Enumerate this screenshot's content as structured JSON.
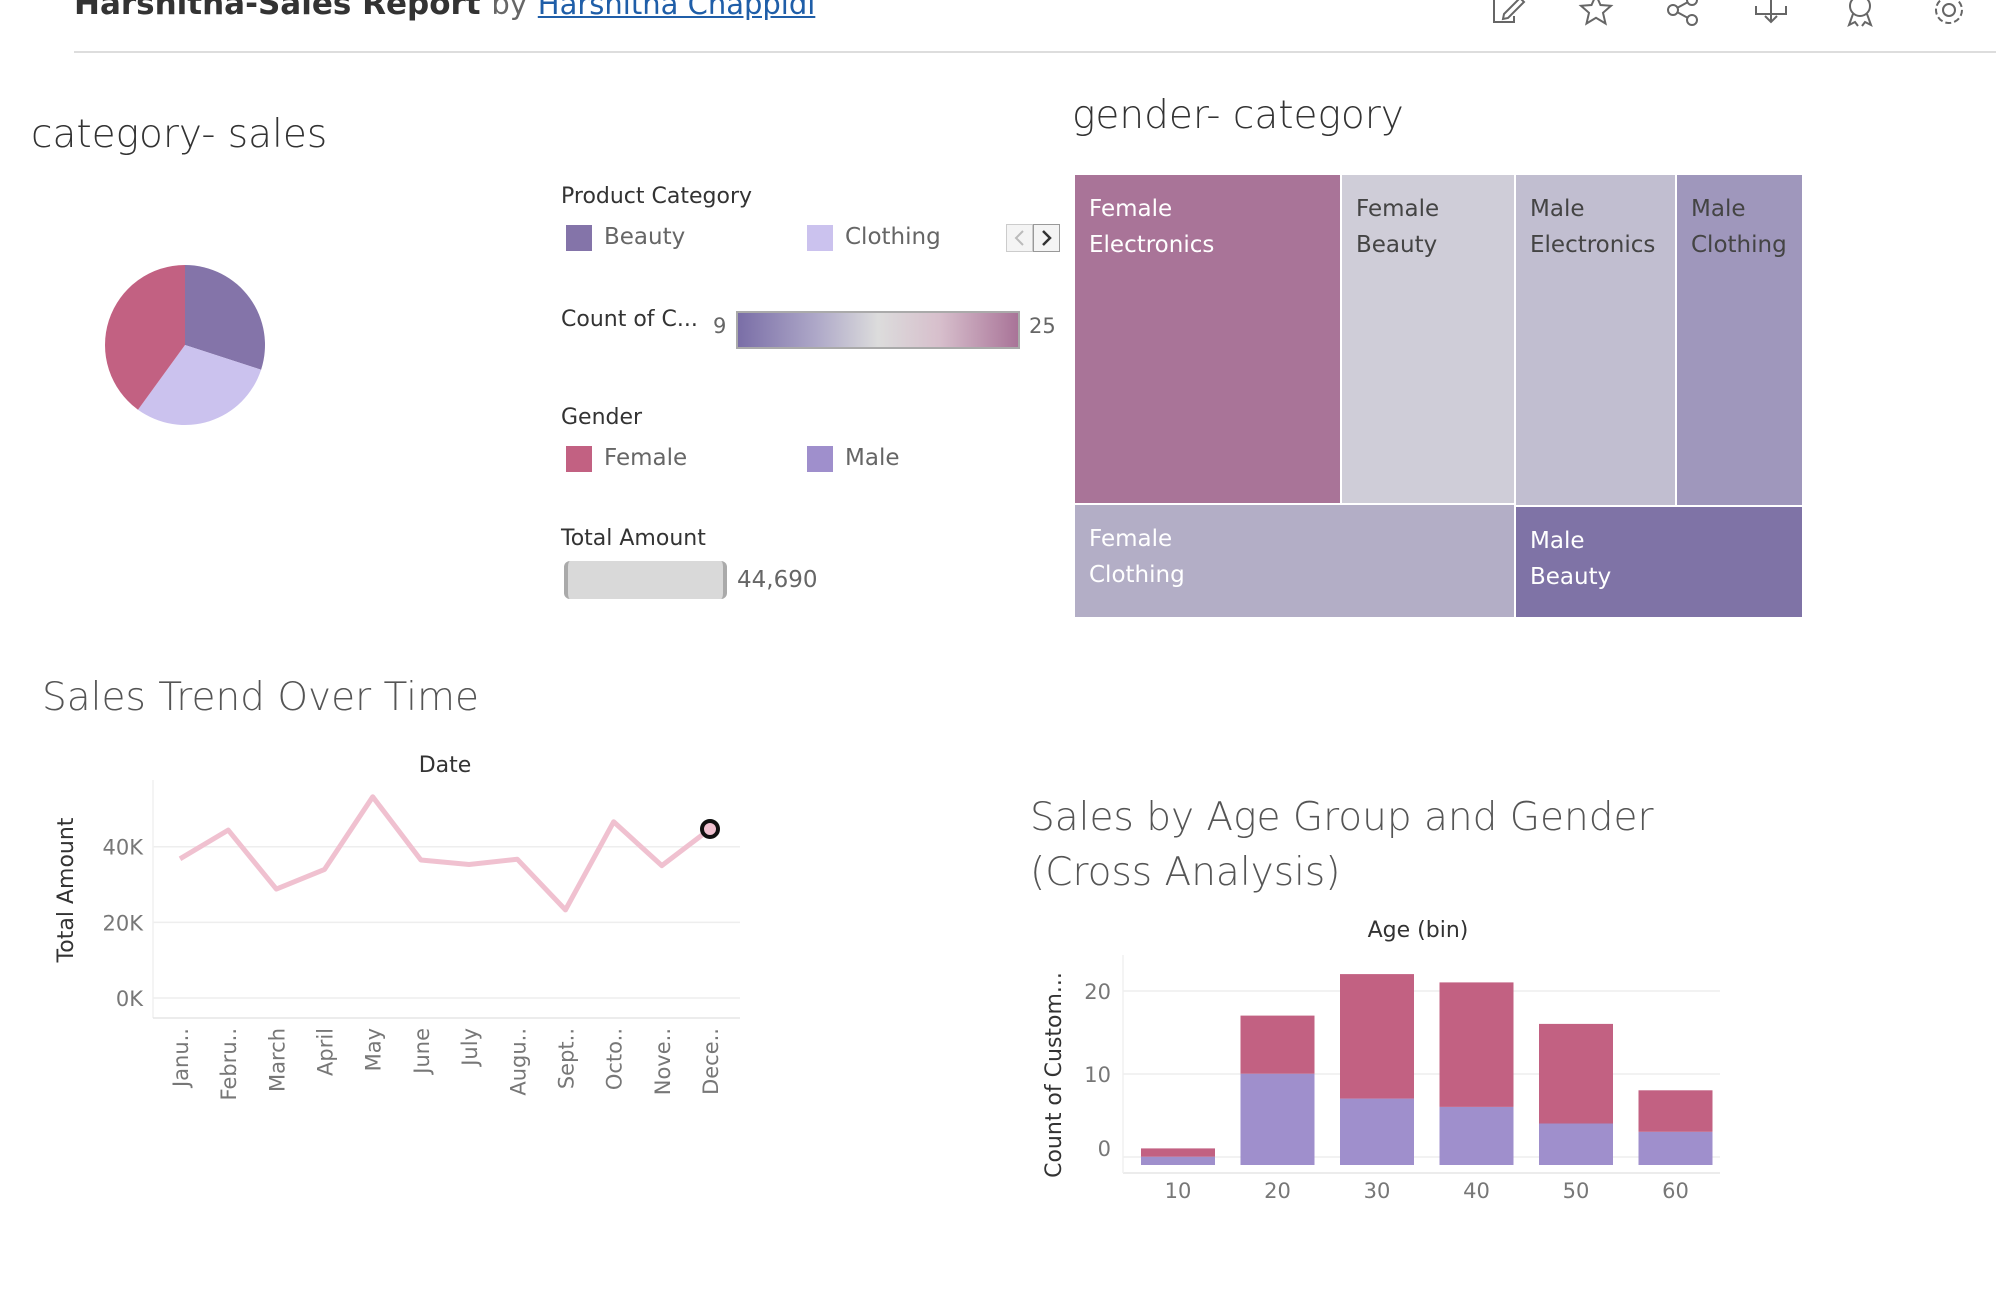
{
  "header": {
    "title": "Harshitha-Sales Report",
    "by": "by",
    "author": "Harshitha Chappidi",
    "icons": [
      "edit-icon",
      "star-icon",
      "share-icon",
      "download-icon",
      "badge-icon",
      "gear-icon"
    ]
  },
  "pie": {
    "title": "category- sales",
    "slices": [
      {
        "category": "Beauty",
        "fraction": 0.3,
        "color": "#8474a9"
      },
      {
        "category": "Clothing",
        "fraction": 0.3,
        "color": "#cbc2ee"
      },
      {
        "category": "Electronics",
        "fraction": 0.4,
        "color": "#c26182"
      }
    ]
  },
  "legends": {
    "product_category": {
      "title": "Product Category",
      "items": [
        {
          "label": "Beauty",
          "color": "#8474a9"
        },
        {
          "label": "Clothing",
          "color": "#cbc2ee"
        }
      ]
    },
    "count": {
      "title": "Count of C...",
      "min": "9",
      "max": "25"
    },
    "gender": {
      "title": "Gender",
      "items": [
        {
          "label": "Female",
          "color": "#c26182"
        },
        {
          "label": "Male",
          "color": "#9f8fcc"
        }
      ]
    },
    "total": {
      "title": "Total Amount",
      "value": "44,690"
    }
  },
  "treemap": {
    "title": "gender- category",
    "cells": [
      {
        "line1": "Female",
        "line2": "Electronics",
        "color": "#a97498",
        "text_color": "#ffffff"
      },
      {
        "line1": "Female",
        "line2": "Beauty",
        "color": "#cfcdd8",
        "text_color": "#444444"
      },
      {
        "line1": "Male",
        "line2": "Electronics",
        "color": "#c1bed0",
        "text_color": "#444444"
      },
      {
        "line1": "Male",
        "line2": "Clothing",
        "color": "#9f97bc",
        "text_color": "#444444"
      },
      {
        "line1": "Female",
        "line2": "Clothing",
        "color": "#b3aec6",
        "text_color": "#ffffff"
      },
      {
        "line1": "Male",
        "line2": "Beauty",
        "color": "#7f73a6",
        "text_color": "#ffffff"
      }
    ]
  },
  "line_chart": {
    "title": "Sales Trend Over Time"
  },
  "bar_chart": {
    "title_line1": "Sales by Age Group and Gender",
    "title_line2": "(Cross Analysis)"
  },
  "chart_data": [
    {
      "type": "line",
      "title": "Sales Trend Over Time",
      "xlabel": "Date",
      "ylabel": "Total Amount",
      "categories": [
        "Janu..",
        "Febru..",
        "March",
        "April",
        "May",
        "June",
        "July",
        "Augu..",
        "Sept..",
        "Octo..",
        "Nove..",
        "Dece.."
      ],
      "values": [
        36800,
        44400,
        28800,
        34000,
        53200,
        36500,
        35300,
        36700,
        23300,
        46600,
        35000,
        44690
      ],
      "yticks": [
        "0K",
        "20K",
        "40K"
      ],
      "ylim": [
        0,
        55000
      ],
      "color": "#f0c1d0",
      "highlight_index": 11
    },
    {
      "type": "bar",
      "stacked": true,
      "xlabel": "Age (bin)",
      "ylabel": "Count of Custom...",
      "categories": [
        "10",
        "20",
        "30",
        "40",
        "50",
        "60"
      ],
      "series": [
        {
          "name": "Male",
          "color": "#9f8fcc",
          "values": [
            1,
            11,
            8,
            7,
            5,
            4
          ]
        },
        {
          "name": "Female",
          "color": "#c26182",
          "values": [
            1,
            7,
            15,
            15,
            12,
            5
          ]
        }
      ],
      "yticks": [
        "0",
        "10",
        "20"
      ],
      "ylim": [
        0,
        23
      ]
    }
  ]
}
